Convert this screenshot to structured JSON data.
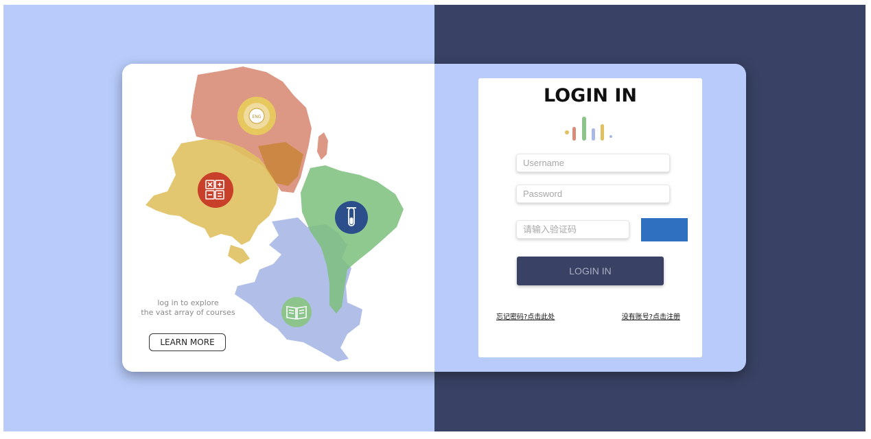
{
  "left_panel": {
    "tagline_line1": "log in to explore",
    "tagline_line2": "the vast array of courses",
    "learn_more_label": "LEARN MORE",
    "badges": {
      "africa_text": "ENG",
      "africa_icon": "eng-language-icon",
      "asia_icon": "calculator-icon",
      "south_america_icon": "test-tube-icon",
      "north_america_icon": "book-icon"
    }
  },
  "login": {
    "title": "LOGIN IN",
    "username_placeholder": "Username",
    "password_placeholder": "Password",
    "captcha_placeholder": "请输入验证码",
    "submit_label": "LOGIN IN",
    "forgot_link": "忘记密码?点击此处",
    "register_link": "没有账号?点击注册"
  },
  "colors": {
    "background_left": "#b8cbfa",
    "background_right": "#394264",
    "captcha_box": "#3070c0",
    "submit_button": "#394264",
    "africa": "#d98d78",
    "asia": "#e0c060",
    "south_america": "#7dbf7d",
    "north_america": "#aab8e6"
  }
}
